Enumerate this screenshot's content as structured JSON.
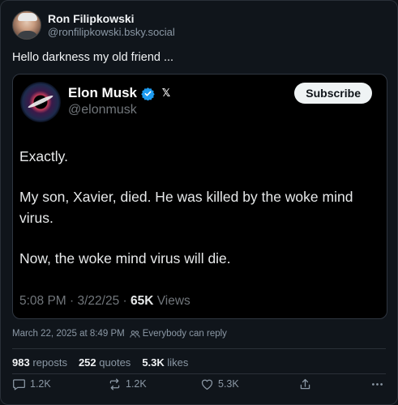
{
  "post": {
    "author_name": "Ron Filipkowski",
    "author_handle": "@ronfilipkowski.bsky.social",
    "text": "Hello darkness my old friend ...",
    "timestamp": "March 22, 2025 at 8:49 PM",
    "reply_setting": "Everybody can reply"
  },
  "quoted": {
    "name": "Elon Musk",
    "handle": "@elonmusk",
    "subscribe_label": "Subscribe",
    "x_logo": "𝕏",
    "paragraphs": [
      "Exactly.",
      "My son, Xavier, died. He was killed by the woke mind virus.",
      "Now, the woke mind virus will die."
    ],
    "time": "5:08 PM · 3/22/25 · ",
    "views_count": "65K",
    "views_label": " Views"
  },
  "stats": {
    "reposts_count": "983",
    "reposts_label": " reposts",
    "quotes_count": "252",
    "quotes_label": " quotes",
    "likes_count": "5.3K",
    "likes_label": " likes"
  },
  "actions": {
    "reply_count": "1.2K",
    "repost_count": "1.2K",
    "like_count": "5.3K"
  },
  "icons": [
    "avatar",
    "verified-badge-icon",
    "x-logo-icon",
    "people-icon",
    "reply-icon",
    "repost-icon",
    "like-icon",
    "share-icon",
    "more-icon"
  ],
  "colors": {
    "background": "#10151b",
    "quote_background": "#000000",
    "verified": "#1d9bf0",
    "muted": "#8b98a5"
  }
}
